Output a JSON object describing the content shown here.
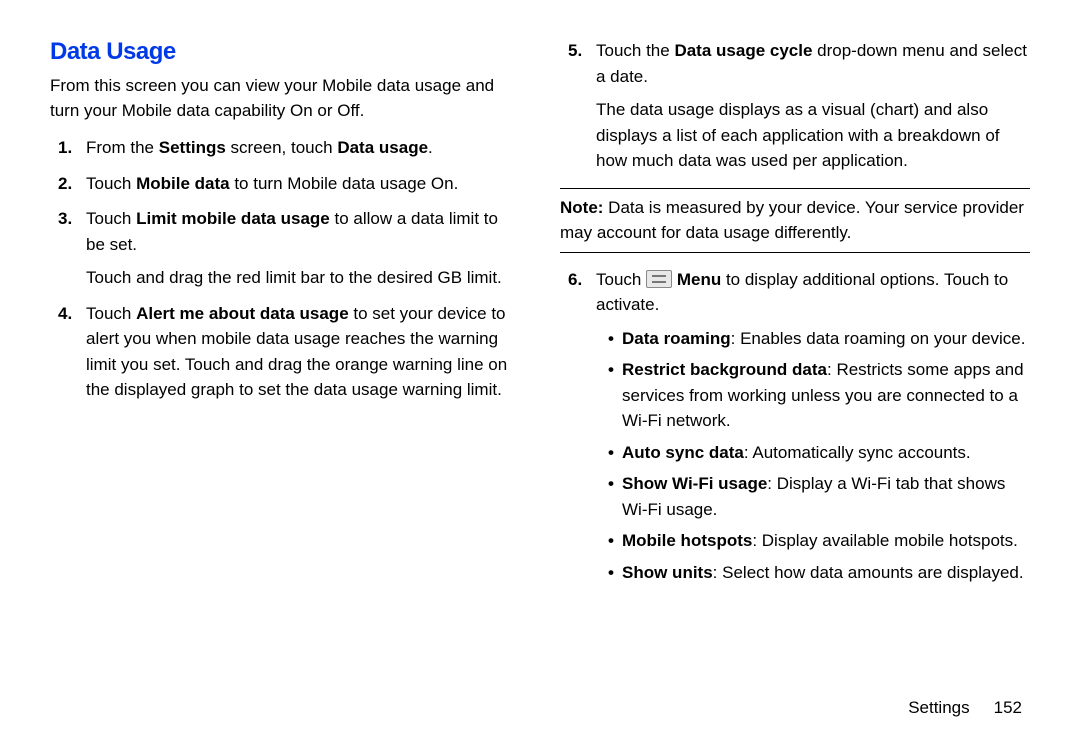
{
  "heading": "Data Usage",
  "intro": "From this screen you can view your Mobile data usage and turn your Mobile data capability On or Off.",
  "steps_left": {
    "s1": {
      "a": "From the ",
      "b": "Settings",
      "c": " screen, touch ",
      "d": "Data usage",
      "e": "."
    },
    "s2": {
      "a": "Touch ",
      "b": "Mobile data",
      "c": " to turn Mobile data usage On."
    },
    "s3": {
      "a": "Touch ",
      "b": "Limit mobile data usage",
      "c": " to allow a data limit to be set.",
      "follow": "Touch and drag the red limit bar to the desired GB limit."
    },
    "s4": {
      "a": "Touch ",
      "b": "Alert me about data usage",
      "c": " to set your device to alert you when mobile data usage reaches the warning limit you set. Touch and drag the orange warning line on the displayed graph to set the data usage warning limit."
    }
  },
  "steps_right": {
    "s5": {
      "a": "Touch the ",
      "b": "Data usage cycle",
      "c": " drop-down menu and select a date.",
      "follow": "The data usage displays as a visual (chart) and also displays a list of each application with a breakdown of how much data was used per application."
    },
    "s6": {
      "a": "Touch ",
      "b": "Menu",
      "c": " to display additional options. Touch to activate."
    }
  },
  "note": {
    "label": "Note:",
    "text": " Data is measured by your device. Your service provider may account for data usage differently."
  },
  "bullets": {
    "b1": {
      "t": "Data roaming",
      "d": ": Enables data roaming on your device."
    },
    "b2": {
      "t": "Restrict background data",
      "d": ": Restricts some apps and services from working unless you are connected to a Wi-Fi network."
    },
    "b3": {
      "t": "Auto sync data",
      "d": ": Automatically sync accounts."
    },
    "b4": {
      "t": "Show Wi-Fi usage",
      "d": ": Display a Wi-Fi tab that shows Wi-Fi usage."
    },
    "b5": {
      "t": "Mobile hotspots",
      "d": ": Display available mobile hotspots."
    },
    "b6": {
      "t": "Show units",
      "d": ": Select how data amounts are displayed."
    }
  },
  "footer": {
    "section": "Settings",
    "page": "152"
  }
}
